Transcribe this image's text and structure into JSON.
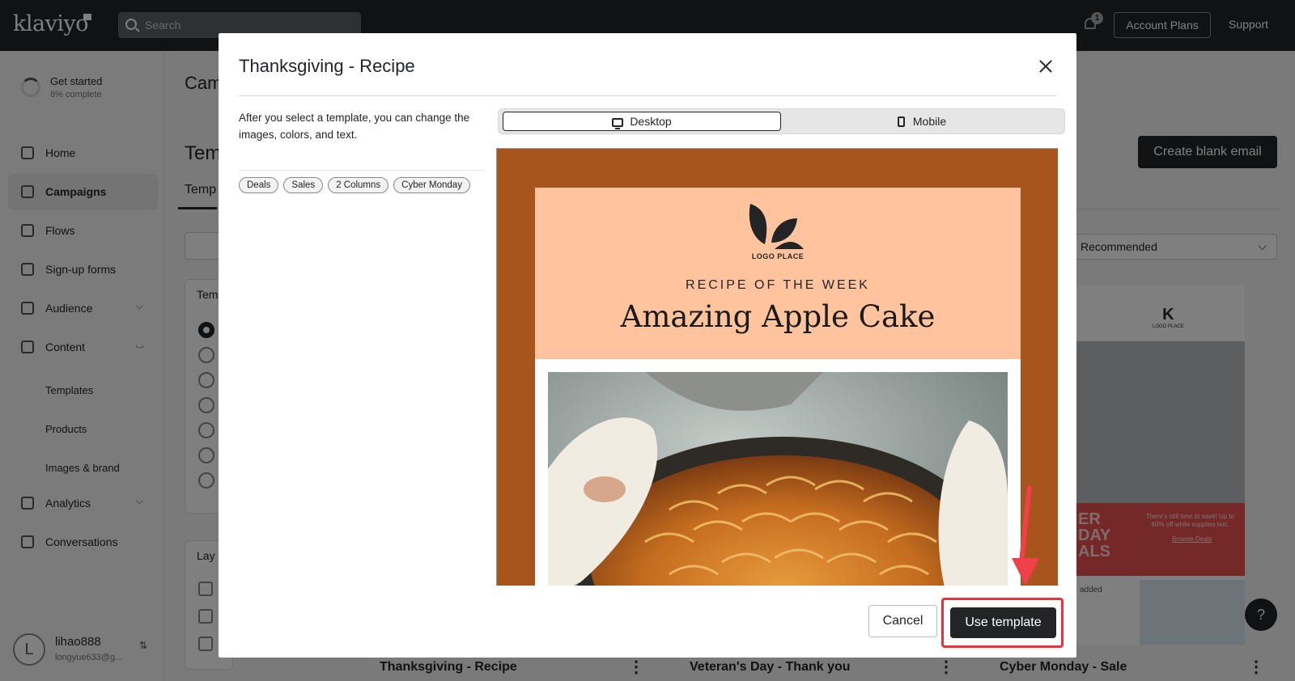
{
  "app": {
    "logo": "klaviyo",
    "search_placeholder": "Search",
    "notification_count": "1",
    "account_button": "Account Plans",
    "support_link": "Support"
  },
  "sidebar": {
    "get_started": {
      "title": "Get started",
      "progress_text": "8% complete",
      "progress": 0.08
    },
    "items": [
      {
        "label": "Home",
        "icon": "home-icon"
      },
      {
        "label": "Campaigns",
        "icon": "campaigns-icon",
        "active": true
      },
      {
        "label": "Flows",
        "icon": "flows-icon"
      },
      {
        "label": "Sign-up forms",
        "icon": "form-icon"
      },
      {
        "label": "Audience",
        "icon": "audience-icon"
      },
      {
        "label": "Content",
        "icon": "content-icon"
      },
      {
        "label": "Analytics",
        "icon": "analytics-icon"
      },
      {
        "label": "Conversations",
        "icon": "chat-icon"
      }
    ],
    "content_sub": [
      "Templates",
      "Products",
      "Images & brand"
    ],
    "user": {
      "initial": "L",
      "name": "lihao888",
      "email": "longyue633@g..."
    }
  },
  "background": {
    "page_title": "Cam",
    "section_title": "Tem",
    "tab": "Temp",
    "filter_card_title": "Tem",
    "layout_card_title": "Lay",
    "create_blank": "Create blank email",
    "sort_value": "Recommended",
    "card_titles": [
      "Thanksgiving - Recipe",
      "Veteran's Day - Thank you",
      "Cyber Monday - Sale"
    ],
    "cyber_card": {
      "logo": "LOGO PLACE",
      "big_text": "ER\nDAY\nALS",
      "small_text": "There's still time to save! Up to 60% off while supplies last.",
      "link": "Browse Deals",
      "added": "added"
    },
    "help": "?"
  },
  "modal": {
    "title": "Thanksgiving - Recipe",
    "description": "After you select a template, you can change the images, colors, and text.",
    "tags": [
      "Deals",
      "Sales",
      "2 Columns",
      "Cyber Monday"
    ],
    "view_options": {
      "desktop": "Desktop",
      "mobile": "Mobile",
      "selected": "desktop"
    },
    "preview": {
      "logo_text": "LOGO PLACE",
      "eyebrow": "RECIPE OF THE WEEK",
      "headline": "Amazing Apple Cake",
      "colors": {
        "frame": "#a8541d",
        "header": "#ffc49e"
      }
    },
    "cancel": "Cancel",
    "use_template": "Use template"
  }
}
